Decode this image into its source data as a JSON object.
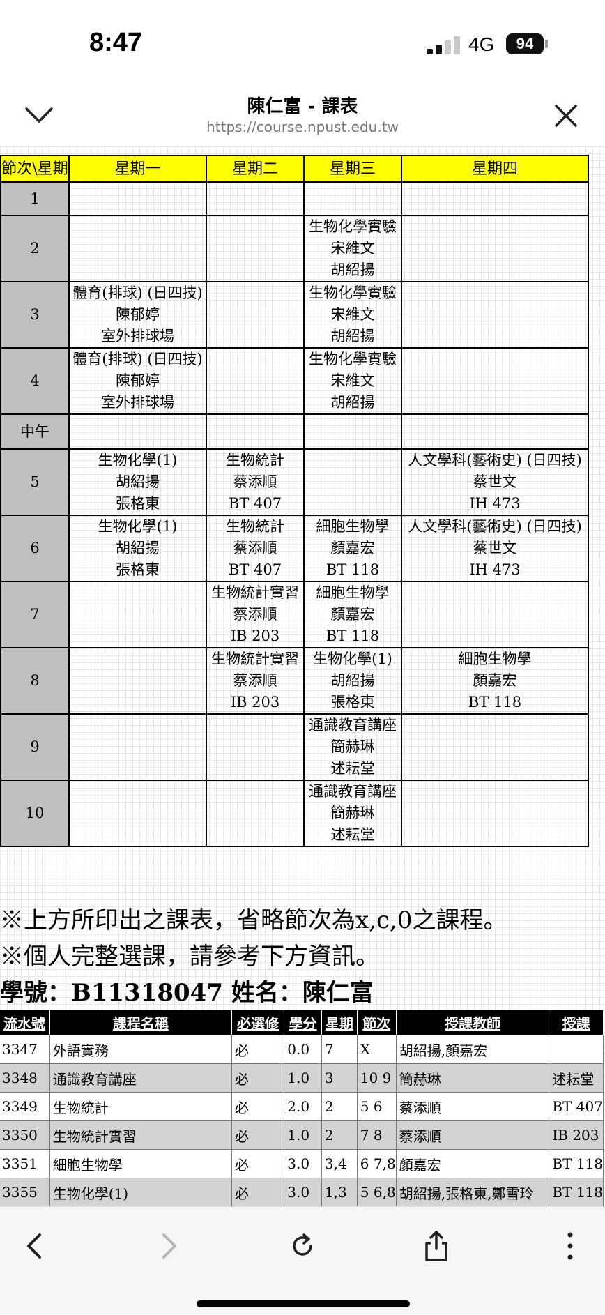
{
  "status_bar": {
    "time": "8:47",
    "network": "4G",
    "battery": "94"
  },
  "browser": {
    "title": "陳仁富 - 課表",
    "url": "https://course.npust.edu.tw"
  },
  "timetable": {
    "header": [
      "節次\\星期",
      "星期一",
      "星期二",
      "星期三",
      "星期四"
    ],
    "rows": [
      {
        "period": "1",
        "cells": [
          [],
          [],
          [],
          []
        ]
      },
      {
        "period": "2",
        "cells": [
          [],
          [],
          [
            "生物化學實驗",
            "宋維文",
            "胡紹揚"
          ],
          []
        ]
      },
      {
        "period": "3",
        "cells": [
          [
            "體育(排球) (日四技)",
            "陳郁婷",
            "室外排球場"
          ],
          [],
          [
            "生物化學實驗",
            "宋維文",
            "胡紹揚"
          ],
          []
        ]
      },
      {
        "period": "4",
        "cells": [
          [
            "體育(排球) (日四技)",
            "陳郁婷",
            "室外排球場"
          ],
          [],
          [
            "生物化學實驗",
            "宋維文",
            "胡紹揚"
          ],
          []
        ]
      },
      {
        "period": "中午",
        "cells": [
          [],
          [],
          [],
          []
        ]
      },
      {
        "period": "5",
        "cells": [
          [
            "生物化學(1)",
            "胡紹揚",
            "張格東"
          ],
          [
            "生物統計",
            "蔡添順",
            "BT 407"
          ],
          [],
          [
            "人文學科(藝術史) (日四技)",
            "蔡世文",
            "IH 473"
          ]
        ]
      },
      {
        "period": "6",
        "cells": [
          [
            "生物化學(1)",
            "胡紹揚",
            "張格東"
          ],
          [
            "生物統計",
            "蔡添順",
            "BT 407"
          ],
          [
            "細胞生物學",
            "顏嘉宏",
            "BT 118"
          ],
          [
            "人文學科(藝術史) (日四技)",
            "蔡世文",
            "IH 473"
          ]
        ]
      },
      {
        "period": "7",
        "cells": [
          [],
          [
            "生物統計實習",
            "蔡添順",
            "IB 203"
          ],
          [
            "細胞生物學",
            "顏嘉宏",
            "BT 118"
          ],
          []
        ]
      },
      {
        "period": "8",
        "cells": [
          [],
          [
            "生物統計實習",
            "蔡添順",
            "IB 203"
          ],
          [
            "生物化學(1)",
            "胡紹揚",
            "張格東"
          ],
          [
            "細胞生物學",
            "顏嘉宏",
            "BT 118"
          ]
        ]
      },
      {
        "period": "9",
        "cells": [
          [],
          [],
          [
            "通識教育講座",
            "簡赫琳",
            "述耘堂"
          ],
          []
        ]
      },
      {
        "period": "10",
        "cells": [
          [],
          [],
          [
            "通識教育講座",
            "簡赫琳",
            "述耘堂"
          ],
          []
        ]
      }
    ]
  },
  "notes": {
    "line1": "※上方所印出之課表，省略節次為x,c,0之課程。",
    "line2": "※個人完整選課，請參考下方資訊。",
    "student": "學號：B11318047 姓名：陳仁富"
  },
  "courses": {
    "headers": [
      "流水號",
      "課程名稱",
      "必選修",
      "學分",
      "星期",
      "節次",
      "授課教師",
      "授課"
    ],
    "rows": [
      [
        "3347",
        "外語實務",
        "必",
        "0.0",
        "7",
        "X",
        "胡紹揚,顏嘉宏",
        ""
      ],
      [
        "3348",
        "通識教育講座",
        "必",
        "1.0",
        "3",
        "10 9",
        "簡赫琳",
        "述耘堂"
      ],
      [
        "3349",
        "生物統計",
        "必",
        "2.0",
        "2",
        "5 6",
        "蔡添順",
        "BT 407"
      ],
      [
        "3350",
        "生物統計實習",
        "必",
        "1.0",
        "2",
        "7 8",
        "蔡添順",
        "IB 203"
      ],
      [
        "3351",
        "細胞生物學",
        "必",
        "3.0",
        "3,4",
        "6 7,8",
        "顏嘉宏",
        "BT 118"
      ],
      [
        "3355",
        "生物化學(1)",
        "必",
        "3.0",
        "1,3",
        "5 6,8",
        "胡紹揚,張格東,鄭雪玲",
        "BT 118"
      ]
    ]
  },
  "toolbar": {
    "back": "back-icon",
    "forward": "forward-icon",
    "reload": "reload-icon",
    "share": "share-icon",
    "more": "more-icon"
  }
}
